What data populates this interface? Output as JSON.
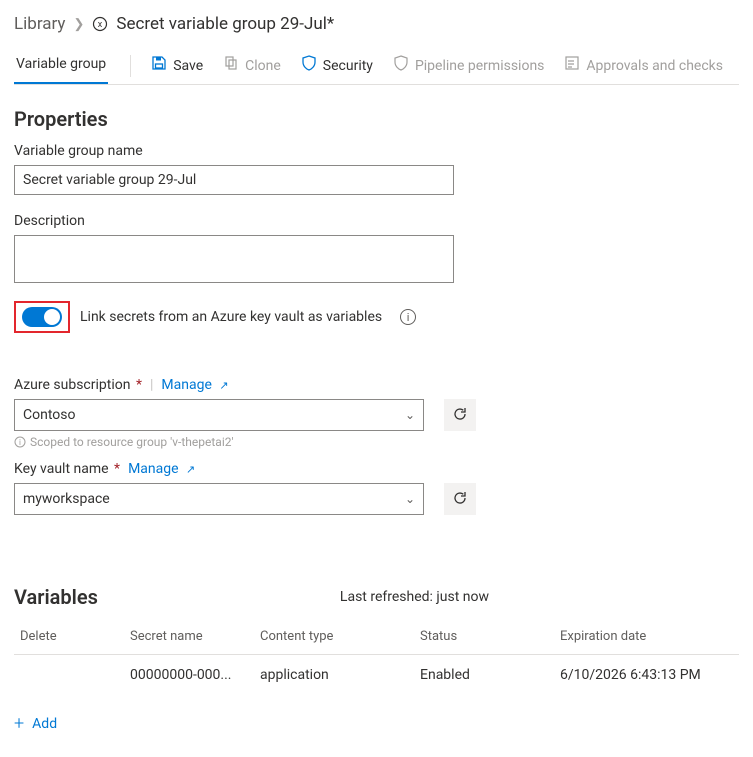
{
  "breadcrumb": {
    "root": "Library",
    "title": "Secret variable group 29-Jul*"
  },
  "tabs": {
    "main": "Variable group"
  },
  "toolbar": {
    "save": "Save",
    "clone": "Clone",
    "security": "Security",
    "pipeline_permissions": "Pipeline permissions",
    "approvals_checks": "Approvals and checks"
  },
  "properties": {
    "heading": "Properties",
    "name_label": "Variable group name",
    "name_value": "Secret variable group 29-Jul",
    "description_label": "Description",
    "description_value": "",
    "link_toggle_label": "Link secrets from an Azure key vault as variables",
    "link_toggle_on": true
  },
  "linked": {
    "subscription_label": "Azure subscription",
    "manage": "Manage",
    "subscription_value": "Contoso",
    "scope_hint": "Scoped to resource group 'v-thepetai2'",
    "keyvault_label": "Key vault name",
    "keyvault_value": "myworkspace"
  },
  "variables": {
    "heading": "Variables",
    "last_refreshed": "Last refreshed: just now",
    "columns": {
      "delete": "Delete",
      "secret_name": "Secret name",
      "content_type": "Content type",
      "status": "Status",
      "expiration": "Expiration date"
    },
    "rows": [
      {
        "secret_name": "00000000-000...",
        "content_type": "application",
        "status": "Enabled",
        "expiration": "6/10/2026 6:43:13 PM"
      }
    ],
    "add": "Add"
  }
}
